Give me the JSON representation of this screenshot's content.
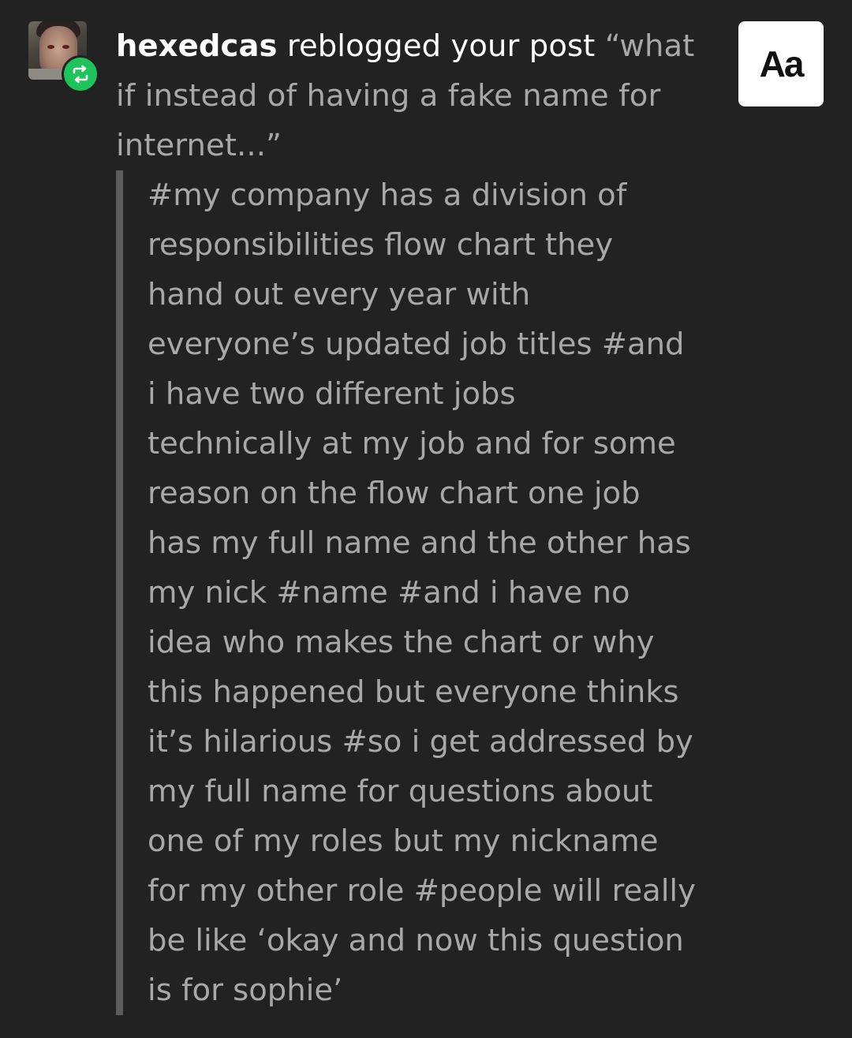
{
  "notification": {
    "username": "hexedcas",
    "action": " reblogged your post ",
    "title_lines": [
      "“what",
      "if instead of having a fake name for",
      "internet...”"
    ]
  },
  "text_size_button": {
    "label": "Aa"
  },
  "tags_lines": [
    "#my company has a division of",
    "responsibilities flow chart they",
    "hand out every year with",
    "everyone’s updated job titles #and",
    "i have two different jobs",
    "technically at my job and for some",
    "reason on the flow chart one job",
    "has my full name and the other has",
    "my nick #name #and i have no",
    "idea who makes the chart or why",
    "this happened but everyone thinks",
    "it’s hilarious #so i get addressed by",
    "my full name for questions about",
    "one of my roles but my nickname",
    "for my other role #people will really",
    "be like ‘okay and now this question",
    "is for sophie’"
  ],
  "colors": {
    "background": "#222222",
    "username": "#ffffff",
    "muted_text": "#a8a8a8",
    "reblog_green": "#1fc35b",
    "quote_bar": "#5c5c5c"
  },
  "icons": {
    "avatar": "user-avatar",
    "badge": "reblog-icon"
  }
}
